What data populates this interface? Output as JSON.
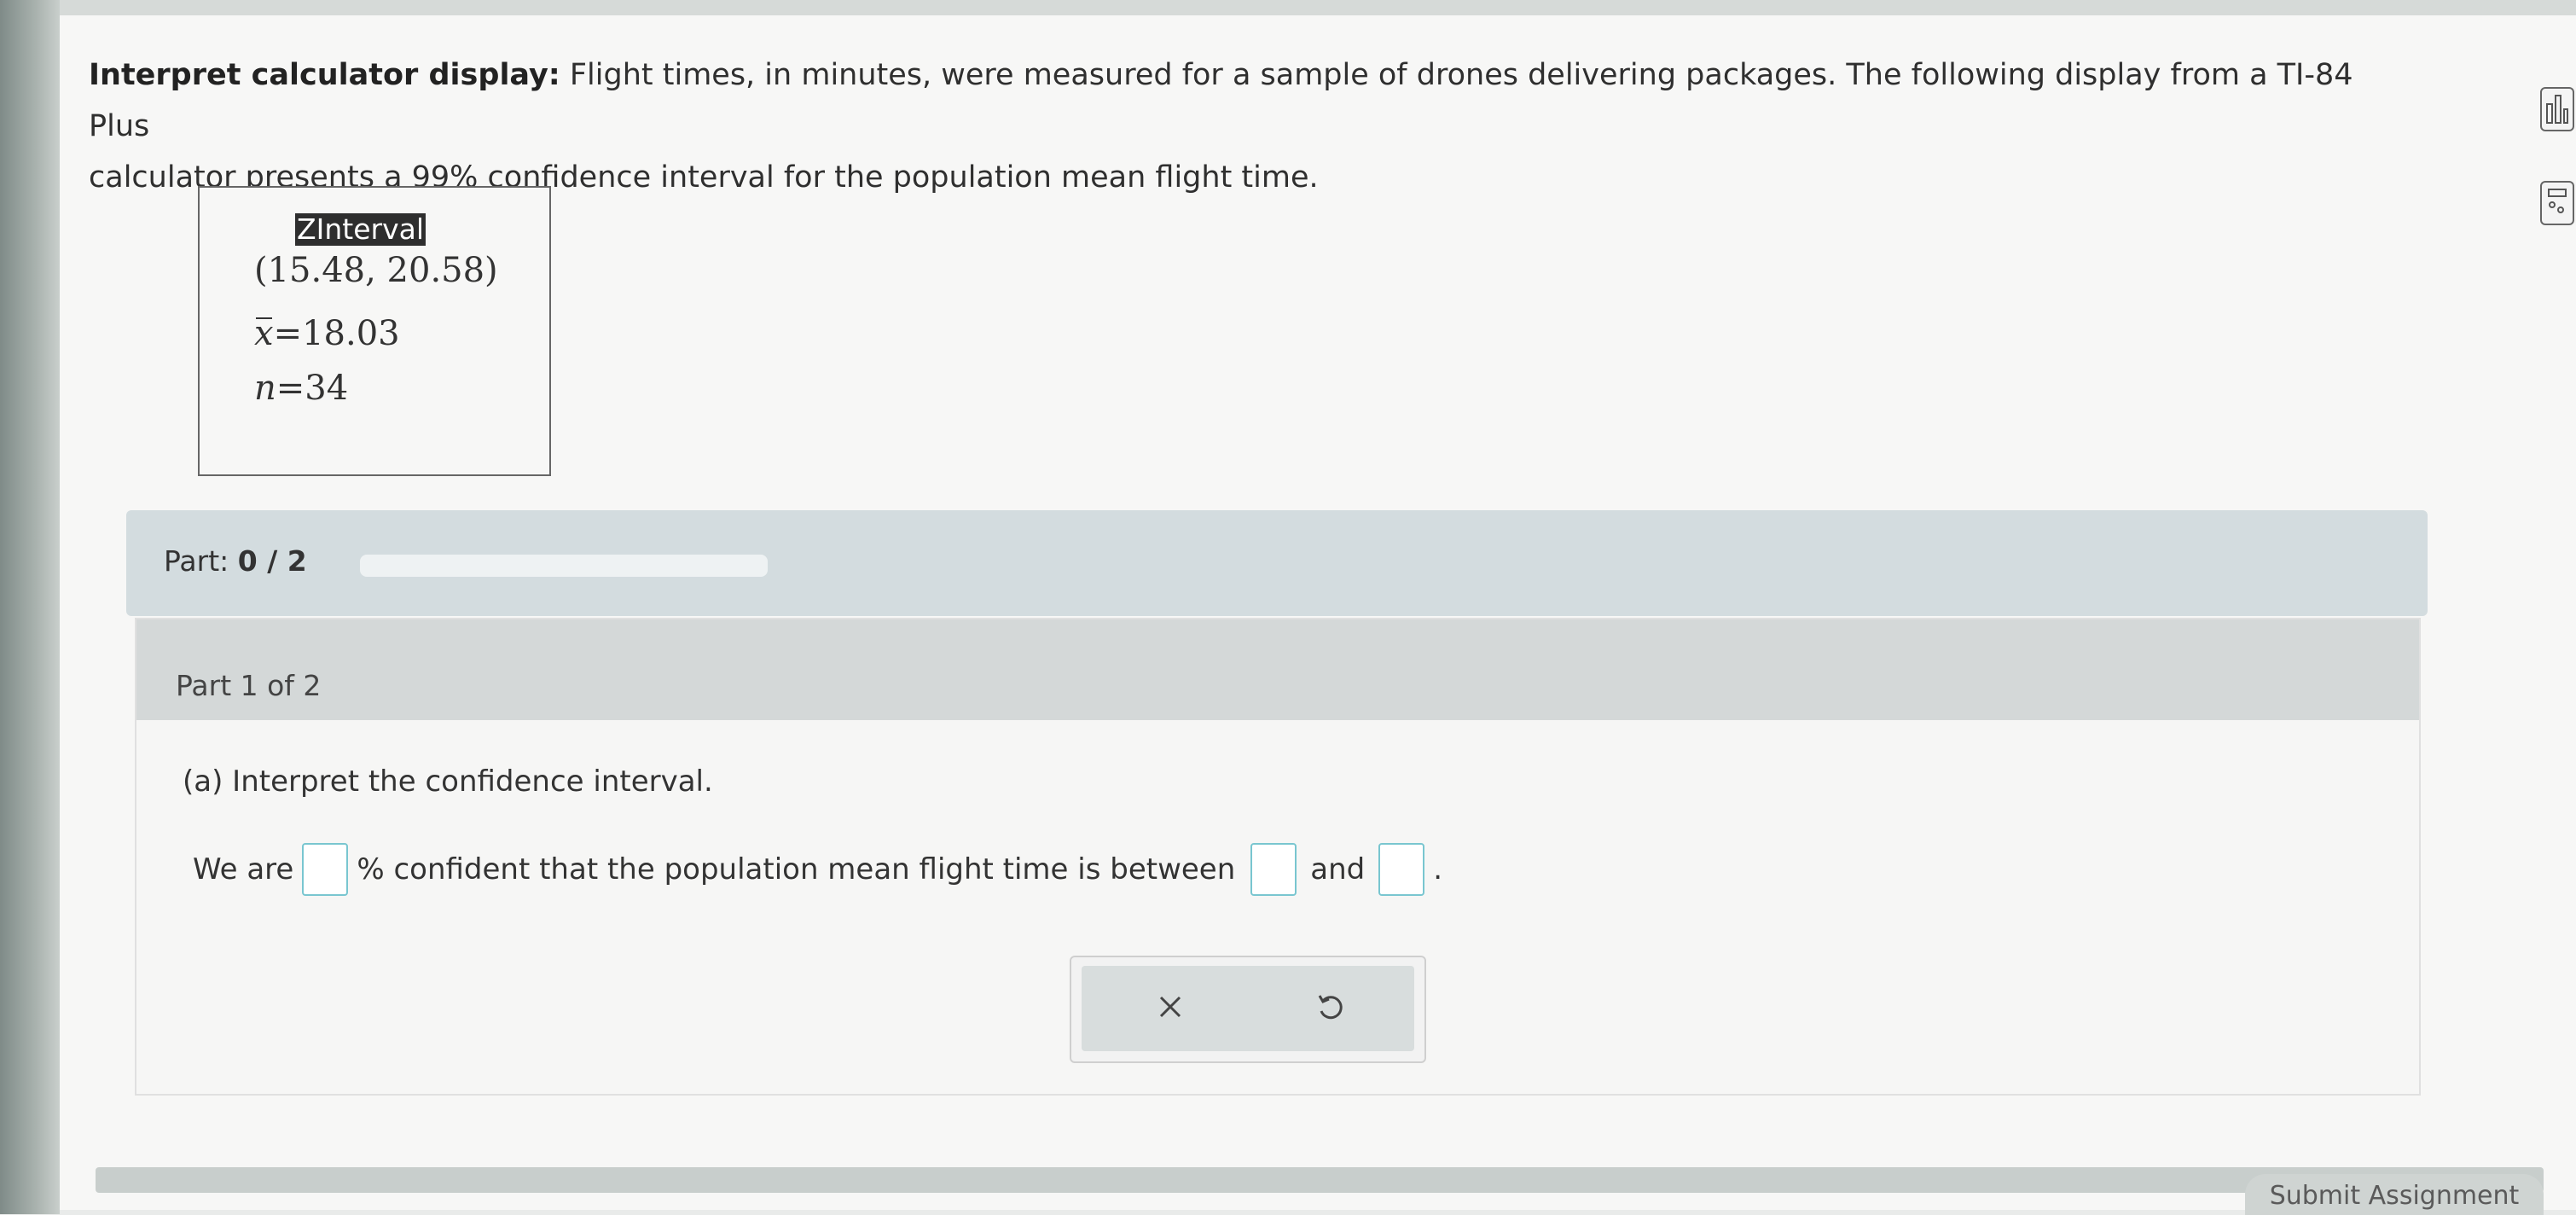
{
  "question": {
    "heading": "Interpret calculator display:",
    "text_line1": " Flight times, in minutes, were measured for a sample of drones delivering packages. The following display from a TI-84 Plus",
    "text_line2": "calculator presents a 99% confidence interval for the population mean flight time."
  },
  "calculator": {
    "title": "ZInterval",
    "interval": "(15.48, 20.58)",
    "xbar_symbol": "x",
    "xbar_value": "=18.03",
    "n_symbol": "n",
    "n_value": "=34"
  },
  "progress": {
    "label": "Part:",
    "value": "0 / 2",
    "fraction": 0
  },
  "part1": {
    "title": "Part 1 of 2",
    "question": "(a) Interpret the confidence interval.",
    "sentence_start": "We are",
    "sentence_mid": "% confident that the population mean flight time is between",
    "sentence_and": "and",
    "sentence_end": "."
  },
  "actions": {
    "clear_icon": "close-icon",
    "undo_icon": "undo-icon"
  },
  "footer": {
    "submit_label": "Submit Assignment"
  },
  "colors": {
    "input_border": "#79c6d0",
    "progress_bar_bg": "#d3dcdf",
    "part_header_bg": "#d4d8d8"
  }
}
